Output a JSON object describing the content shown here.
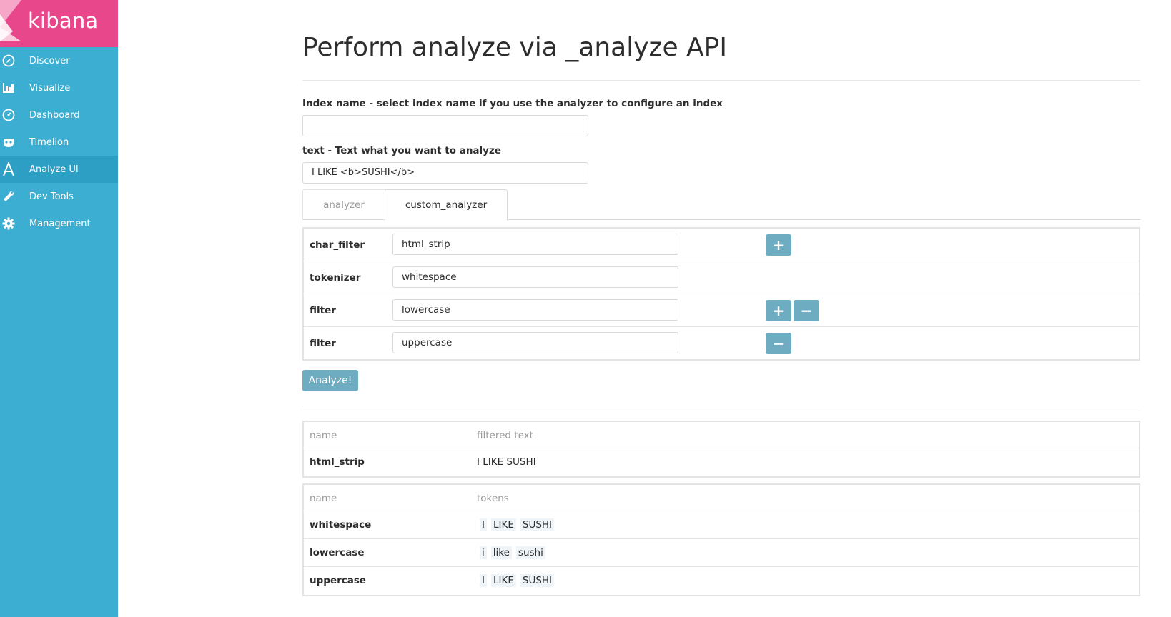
{
  "app": {
    "logo_text": "kibana",
    "colors": {
      "sidebar": "#3caed2",
      "logo_bg": "#e8488b",
      "button": "#6eadc1"
    }
  },
  "sidebar": {
    "items": [
      {
        "label": "Discover",
        "icon": "compass-icon"
      },
      {
        "label": "Visualize",
        "icon": "bar-chart-icon"
      },
      {
        "label": "Dashboard",
        "icon": "dashboard-gauge-icon"
      },
      {
        "label": "Timelion",
        "icon": "timelion-mask-icon"
      },
      {
        "label": "Analyze UI",
        "icon": "letter-a-icon",
        "active": true
      },
      {
        "label": "Dev Tools",
        "icon": "wrench-icon"
      },
      {
        "label": "Management",
        "icon": "gear-icon"
      }
    ]
  },
  "page": {
    "title": "Perform analyze via _analyze API",
    "index_label": "Index name - select index name if you use the analyzer to configure an index",
    "index_value": "",
    "text_label": "text - Text what you want to analyze",
    "text_value": "I LIKE <b>SUSHI</b>"
  },
  "tabs": [
    {
      "label": "analyzer",
      "active": false
    },
    {
      "label": "custom_analyzer",
      "active": true
    }
  ],
  "config": {
    "rows": [
      {
        "name": "char_filter",
        "value": "html_strip",
        "buttons": [
          "+"
        ]
      },
      {
        "name": "tokenizer",
        "value": "whitespace",
        "buttons": []
      },
      {
        "name": "filter",
        "value": "lowercase",
        "buttons": [
          "+",
          "−"
        ]
      },
      {
        "name": "filter",
        "value": "uppercase",
        "buttons": [
          "−"
        ]
      }
    ],
    "analyze_label": "Analyze!"
  },
  "char_filter_result": {
    "headers": [
      "name",
      "filtered text"
    ],
    "rows": [
      {
        "name": "html_strip",
        "text": "I LIKE SUSHI"
      }
    ]
  },
  "token_result": {
    "headers": [
      "name",
      "tokens"
    ],
    "rows": [
      {
        "name": "whitespace",
        "tokens": [
          "I",
          "LIKE",
          "SUSHI"
        ]
      },
      {
        "name": "lowercase",
        "tokens": [
          "i",
          "like",
          "sushi"
        ]
      },
      {
        "name": "uppercase",
        "tokens": [
          "I",
          "LIKE",
          "SUSHI"
        ]
      }
    ]
  }
}
